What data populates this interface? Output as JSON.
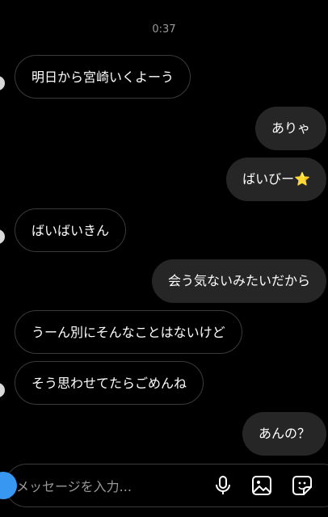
{
  "thread": {
    "timestamp": "0:37",
    "messages": [
      {
        "direction": "in",
        "text": "明日から宮崎いくよーう"
      },
      {
        "direction": "out",
        "text": "ありゃ"
      },
      {
        "direction": "out",
        "text": "ばいびー⭐"
      },
      {
        "direction": "in",
        "text": "ばいばいきん"
      },
      {
        "direction": "out",
        "text": "会う気ないみたいだから"
      },
      {
        "direction": "in",
        "text": "うーん別にそんなことはないけど"
      },
      {
        "direction": "in",
        "text": "そう思わせてたらごめんね"
      },
      {
        "direction": "out",
        "text": "あんの？"
      }
    ]
  },
  "composer": {
    "placeholder": "メッセージを入力...",
    "value": ""
  },
  "icons": {
    "camera": "camera-icon",
    "mic": "microphone-icon",
    "gallery": "image-gallery-icon",
    "sticker": "sticker-icon"
  },
  "colors": {
    "background": "#000000",
    "outgoing_bubble": "#262626",
    "incoming_border": "#3a3a3a",
    "accent": "#3897f0"
  }
}
